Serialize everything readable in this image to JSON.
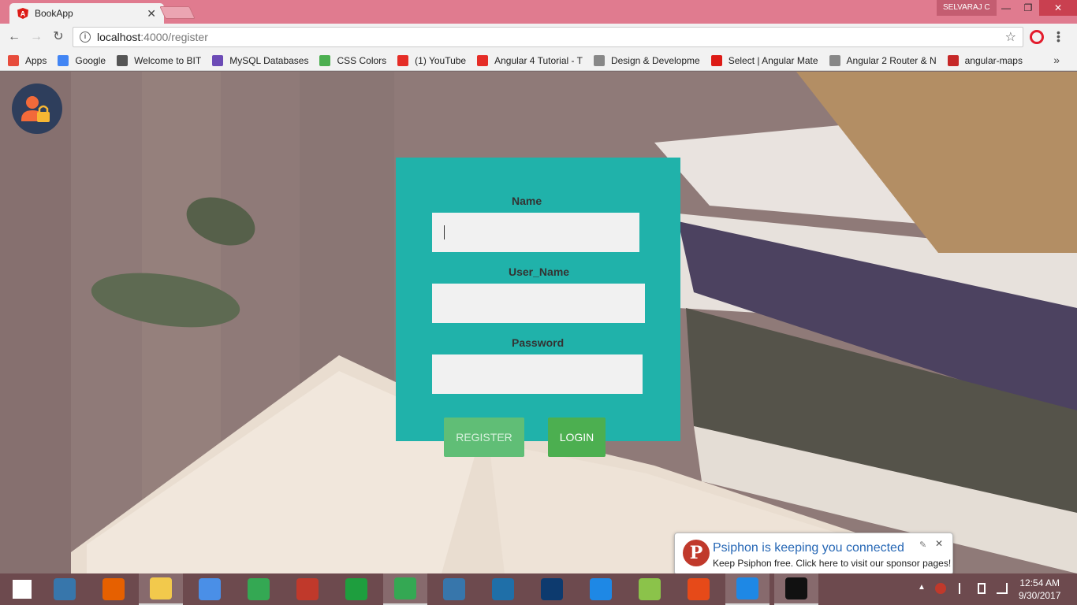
{
  "browser": {
    "tab_title": "BookApp",
    "tab_close": "✕",
    "user_badge": "SELVARAJ C",
    "window_buttons": {
      "min": "—",
      "max": "❐",
      "close": "✕"
    },
    "url_host": "localhost",
    "url_path": ":4000/register",
    "nav": {
      "back": "←",
      "forward": "→",
      "reload": "↻"
    },
    "star": "☆",
    "more_bookmarks": "»"
  },
  "bookmarks": [
    {
      "label": "Apps",
      "icon": "apps-grid-icon",
      "color": "#e74c3c"
    },
    {
      "label": "Google",
      "icon": "google-icon",
      "color": "#4285f4"
    },
    {
      "label": "Welcome to BIT",
      "icon": "bit-icon",
      "color": "#555555"
    },
    {
      "label": "MySQL Databases",
      "icon": "mysql-icon",
      "color": "#6c4bb6"
    },
    {
      "label": "CSS Colors",
      "icon": "w3-icon",
      "color": "#4caf50"
    },
    {
      "label": "(1) YouTube",
      "icon": "youtube-icon",
      "color": "#e52d27"
    },
    {
      "label": "Angular 4 Tutorial - T",
      "icon": "youtube-icon",
      "color": "#e52d27"
    },
    {
      "label": "Design & Developme",
      "icon": "page-icon",
      "color": "#888888"
    },
    {
      "label": "Select | Angular Mate",
      "icon": "angular-icon",
      "color": "#dd1b16"
    },
    {
      "label": "Angular 2 Router & N",
      "icon": "page-icon",
      "color": "#888888"
    },
    {
      "label": "angular-maps",
      "icon": "maps-icon",
      "color": "#c62828"
    }
  ],
  "form": {
    "name_label": "Name",
    "username_label": "User_Name",
    "password_label": "Password",
    "name_value": "",
    "username_value": "",
    "password_value": "",
    "register_label": "REGISTER",
    "login_label": "LOGIN",
    "accent_color": "#20b2aa"
  },
  "notification": {
    "logo": "P",
    "title": "Psiphon is keeping you connected",
    "body": "Keep Psiphon free. Click here to visit our sponsor pages!",
    "pin": "✎",
    "close": "✕"
  },
  "taskbar": {
    "time": "12:54 AM",
    "date": "9/30/2017",
    "tray_up": "▲",
    "apps": [
      {
        "name": "start-button",
        "icon": "windows-icon",
        "color": "#ffffff",
        "active": false
      },
      {
        "name": "python-idle",
        "icon": "python-file-icon",
        "color": "#3776ab",
        "active": false
      },
      {
        "name": "firefox",
        "icon": "firefox-icon",
        "color": "#e66000",
        "active": false
      },
      {
        "name": "file-explorer",
        "icon": "folder-icon",
        "color": "#f2c94c",
        "active": true
      },
      {
        "name": "chromium",
        "icon": "chromium-icon",
        "color": "#4a8fe7",
        "active": false
      },
      {
        "name": "chrome",
        "icon": "chrome-icon",
        "color": "#34a853",
        "active": false
      },
      {
        "name": "psiphon",
        "icon": "psiphon-icon",
        "color": "#c0392b",
        "active": false
      },
      {
        "name": "store",
        "icon": "store-icon",
        "color": "#1e9e3e",
        "active": false
      },
      {
        "name": "chrome-active",
        "icon": "chrome-icon",
        "color": "#34a853",
        "active": true
      },
      {
        "name": "python",
        "icon": "python-icon",
        "color": "#3776ab",
        "active": false
      },
      {
        "name": "brackets",
        "icon": "brackets-icon",
        "color": "#1f6fa8",
        "active": false
      },
      {
        "name": "devcpp",
        "icon": "devcpp-icon",
        "color": "#0d3a6e",
        "active": false
      },
      {
        "name": "screenshot",
        "icon": "capture-icon",
        "color": "#1e88e5",
        "active": false
      },
      {
        "name": "photos",
        "icon": "photos-icon",
        "color": "#8bc34a",
        "active": false
      },
      {
        "name": "tools",
        "icon": "wrench-icon",
        "color": "#e64a19",
        "active": false
      },
      {
        "name": "vscode",
        "icon": "vscode-icon",
        "color": "#1e88e5",
        "active": true
      },
      {
        "name": "cmd",
        "icon": "terminal-icon",
        "color": "#111111",
        "active": true
      }
    ]
  }
}
